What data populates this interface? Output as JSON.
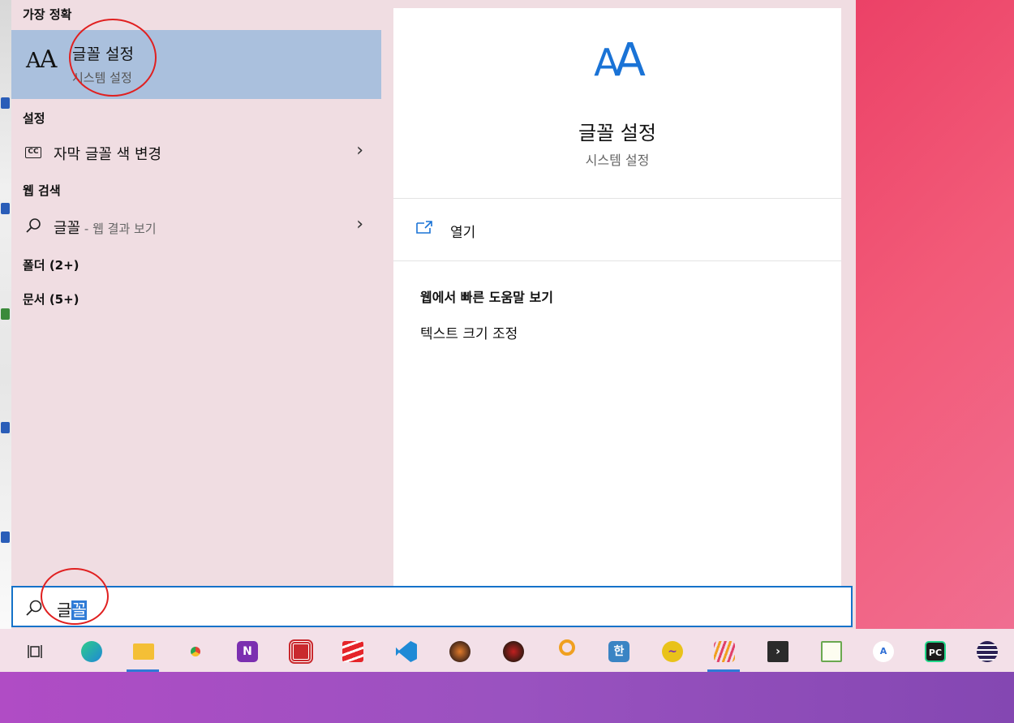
{
  "left_pane": {
    "best_match_header": "가장 정확",
    "best_match": {
      "icon": "font-icon",
      "title": "글꼴 설정",
      "subtitle": "시스템 설정"
    },
    "settings_header": "설정",
    "settings_items": [
      {
        "icon": "closed-caption-icon",
        "label": "자막 글꼴 색 변경"
      }
    ],
    "web_header": "웹 검색",
    "web_items": [
      {
        "icon": "search-icon",
        "label": "글꼴",
        "suffix": " - 웹 결과 보기"
      }
    ],
    "folders_header": "폴더 (2+)",
    "documents_header": "문서 (5+)"
  },
  "right_pane": {
    "title": "글꼴 설정",
    "subtitle": "시스템 설정",
    "open_label": "열기",
    "help_header": "웹에서 빠른 도움말 보기",
    "help_links": [
      "텍스트 크기 조정"
    ]
  },
  "search": {
    "value_unselected": "글",
    "value_selected": "꼴"
  },
  "taskbar": {
    "items": [
      {
        "name": "task-view-icon",
        "color": "#ffffff"
      },
      {
        "name": "edge-icon",
        "color": "#1f88d6"
      },
      {
        "name": "file-explorer-icon",
        "color": "#f4bf36"
      },
      {
        "name": "chrome-icon",
        "color": "#e54335"
      },
      {
        "name": "onenote-icon",
        "color": "#7b2fb0"
      },
      {
        "name": "red-square-app-icon",
        "color": "#c9292e"
      },
      {
        "name": "red-stripes-app-icon",
        "color": "#e5252a"
      },
      {
        "name": "vscode-icon",
        "color": "#1e8ad6"
      },
      {
        "name": "diablo-icon",
        "color": "#4a2a1a"
      },
      {
        "name": "diablo-2-icon",
        "color": "#3a1a12"
      },
      {
        "name": "magnifier-app-icon",
        "color": "#f0a020"
      },
      {
        "name": "hwp-icon",
        "color": "#3a84c4"
      },
      {
        "name": "audio-wave-app-icon",
        "color": "#e9c21a"
      },
      {
        "name": "colorful-lines-app-icon",
        "color": "#e0406a"
      },
      {
        "name": "terminal-app-icon",
        "color": "#2b2b2b"
      },
      {
        "name": "notepad-chart-app-icon",
        "color": "#6aa84f"
      },
      {
        "name": "ai-app-icon",
        "color": "#2f6fd6"
      },
      {
        "name": "pycharm-icon",
        "color": "#1a1a1a"
      },
      {
        "name": "eclipse-icon",
        "color": "#2c2255"
      }
    ]
  }
}
